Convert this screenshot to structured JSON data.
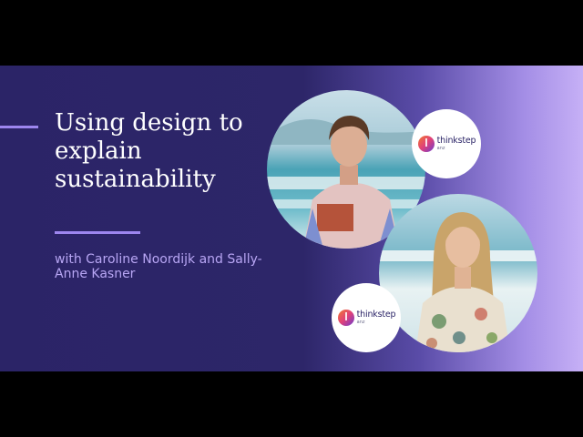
{
  "banner": {
    "title": "Using design to explain sustainability",
    "subtitle": "with Caroline Noordijk and Sally-Anne Kasner"
  },
  "logo": {
    "word": "thinkstep",
    "sub": "anz"
  },
  "photos": {
    "first": "portrait photo",
    "second": "portrait photo"
  },
  "colors": {
    "banner_bg": "#2b2467",
    "gradient_end": "#c6b0f6",
    "accent": "#9d86ef",
    "subtitle_text": "#b8a6f4",
    "title_text": "#ffffff"
  }
}
